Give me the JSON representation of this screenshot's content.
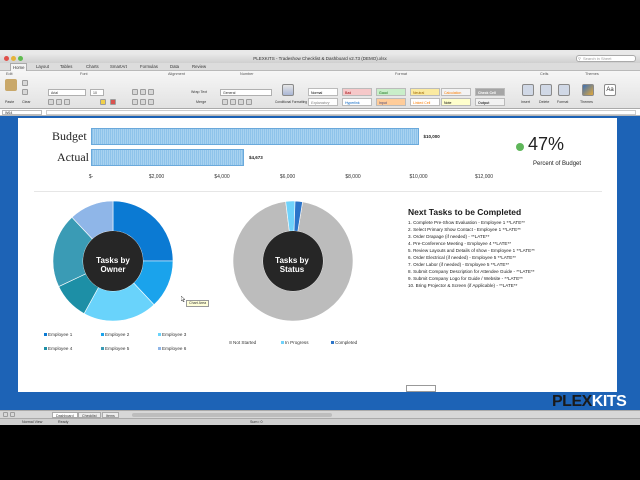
{
  "window": {
    "title": "PLEXKITS - Tradeshow Checklist & Dashboard v2.73 (DEMO).xlsx",
    "search_placeholder": "Search in Sheet"
  },
  "ribbon": {
    "tabs": [
      "Home",
      "Layout",
      "Tables",
      "Charts",
      "SmartArt",
      "Formulas",
      "Data",
      "Review"
    ],
    "active_tab": "Home",
    "groups": [
      "Edit",
      "Font",
      "Alignment",
      "Number",
      "Format",
      "Cells",
      "Themes"
    ],
    "font_name": "Arial",
    "font_size": "10",
    "wrap_text": "Wrap Text",
    "number_format": "General",
    "merge": "Merge",
    "paste": "Paste",
    "clear": "Clear",
    "conditional_formatting": "Conditional Formatting",
    "styles": {
      "normal": "Normal",
      "bad": "Bad",
      "good": "Good",
      "neutral": "Neutral",
      "calculation": "Calculation",
      "check_cell": "Check Cell",
      "explanatory": "Explanatory",
      "hyperlink": "Hyperlink",
      "input": "Input",
      "linked_cell": "Linked Cell",
      "note": "Note",
      "output": "Output"
    },
    "cells_buttons": [
      "Insert",
      "Delete",
      "Format",
      "Themes",
      "Aa"
    ]
  },
  "formula_bar": {
    "name_box": "W64"
  },
  "budget_chart": {
    "labels": {
      "budget": "Budget",
      "actual": "Actual"
    },
    "budget_value_label": "$10,000",
    "actual_value_label": "$4,673",
    "budget_value": 10000,
    "actual_value": 4673,
    "axis_max": 12000,
    "ticks": [
      "$-",
      "$2,000",
      "$4,000",
      "$6,000",
      "$8,000",
      "$10,000",
      "$12,000"
    ],
    "bar_color": "#9fcdee"
  },
  "percent_of_budget": {
    "value": "47%",
    "label": "Percent of Budget",
    "dot_color": "#5fb65a"
  },
  "chart_data": [
    {
      "type": "bar",
      "orientation": "horizontal",
      "categories": [
        "Budget",
        "Actual"
      ],
      "values": [
        10000,
        4673
      ],
      "xlim": [
        0,
        12000
      ]
    },
    {
      "type": "pie",
      "title": "Tasks by Owner",
      "categories": [
        "Employee 1",
        "Employee 2",
        "Employee 3",
        "Employee 4",
        "Employee 5",
        "Employee 6"
      ],
      "values": [
        25,
        13,
        20,
        10,
        20,
        12
      ],
      "colors": [
        "#0b7ad3",
        "#1aa3ec",
        "#69d3fb",
        "#1d8fa6",
        "#3a9bb5",
        "#8fb6e8"
      ]
    },
    {
      "type": "pie",
      "title": "Tasks by Status",
      "categories": [
        "Not Started",
        "In Progress",
        "Completed"
      ],
      "values": [
        95.5,
        2.5,
        2
      ],
      "colors": [
        "#bcbcbc",
        "#6fd2fb",
        "#2b74c9"
      ]
    }
  ],
  "owner_legend": [
    "Employee 1",
    "Employee 2",
    "Employee 3",
    "Employee 4",
    "Employee 5",
    "Employee 6"
  ],
  "status_legend": [
    "Not Started",
    "In Progress",
    "Completed"
  ],
  "next_tasks": {
    "title": "Next Tasks to be Completed",
    "items": [
      "1. Complete Pre-Show Evaluation  - Employee 1 **LATE**",
      "2. Select Primary Show Contact - Employee 1 **LATE**",
      "3. Order Drapage (if needed) - **LATE**",
      "4. Pre-Conference Meeting - Employee 4 **LATE**",
      "5. Review Layouts and Details of show - Employee 1 **LATE**",
      "6. Order Electrical (if needed) - Employee 5 **LATE**",
      "7. Order Labor (if needed) - Employee 5 **LATE**",
      "8. Submit Company Description for Attendee Guide - **LATE**",
      "9. Submit Company Logo for Guide / Website - **LATE**",
      "10. Bring Projector & Screen (if Applicable) - **LATE**"
    ]
  },
  "tooltip": "Chart Area",
  "logo": {
    "part1": "PLEX",
    "part2": "KITS",
    "color1": "#1a1a1a",
    "color2": "#ffffff"
  },
  "sheet_tabs": [
    "Dashboard",
    "Checklist",
    "Items"
  ],
  "status_bar": {
    "view": "Normal View",
    "state": "Ready",
    "sum": "Sum= 0"
  }
}
